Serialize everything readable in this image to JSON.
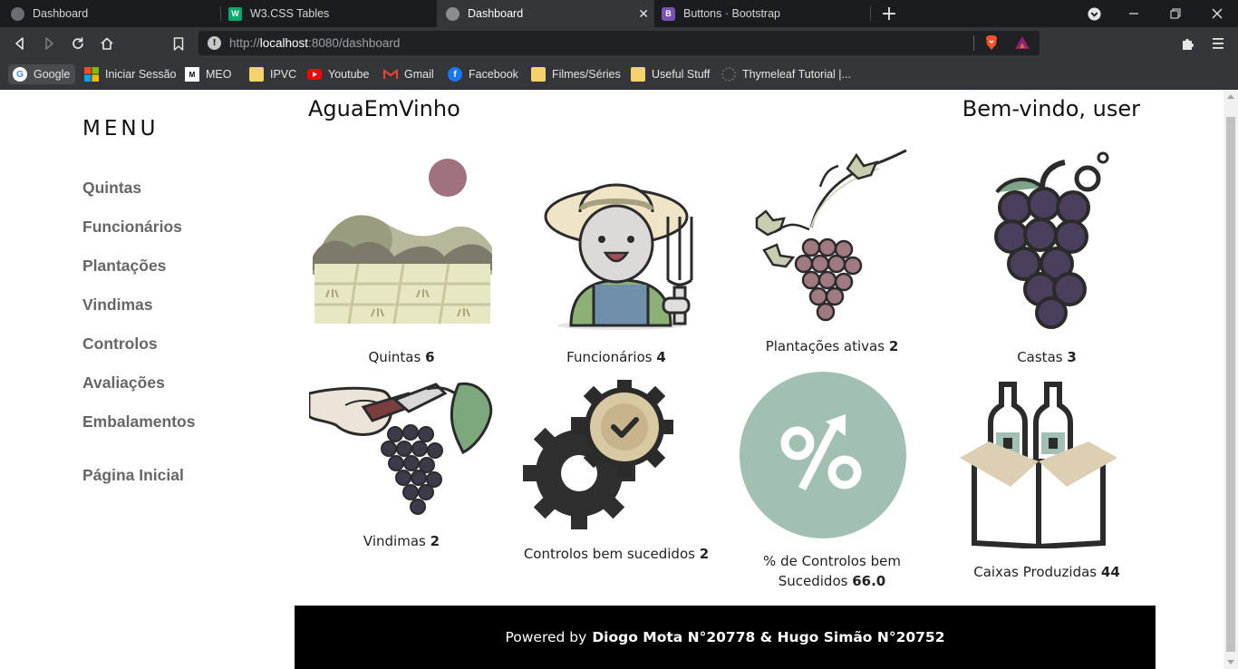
{
  "browser": {
    "tabs": [
      {
        "title": "Dashboard",
        "active": false
      },
      {
        "title": "W3.CSS Tables",
        "active": false
      },
      {
        "title": "Dashboard",
        "active": true
      },
      {
        "title": "Buttons · Bootstrap",
        "active": false
      }
    ],
    "new_tab_label": "+",
    "url_prefix": "http://",
    "url_host": "localhost",
    "url_rest": ":8080/dashboard",
    "bookmarks": [
      {
        "label": "Google"
      },
      {
        "label": "Iniciar Sessão"
      },
      {
        "label": "MEO"
      },
      {
        "label": "IPVC"
      },
      {
        "label": "Youtube"
      },
      {
        "label": "Gmail"
      },
      {
        "label": "Facebook"
      },
      {
        "label": "Filmes/Séries"
      },
      {
        "label": "Useful Stuff"
      },
      {
        "label": "Thymeleaf Tutorial |..."
      }
    ]
  },
  "sidebar": {
    "title": "MENU",
    "items": [
      "Quintas",
      "Funcionários",
      "Plantações",
      "Vindimas",
      "Controlos",
      "Avaliações",
      "Embalamentos"
    ],
    "home": "Página Inicial"
  },
  "header": {
    "brand": "AguaEmVinho",
    "welcome": "Bem-vindo, user"
  },
  "stats": [
    {
      "label": "Quintas",
      "value": "6"
    },
    {
      "label": "Funcionários",
      "value": "4"
    },
    {
      "label": "Plantações ativas",
      "value": "2"
    },
    {
      "label": "Castas",
      "value": "3"
    },
    {
      "label": "Vindimas",
      "value": "2"
    },
    {
      "label": "Controlos bem sucedidos",
      "value": "2"
    },
    {
      "label": "% de Controlos bem Sucedidos",
      "value": "66.0"
    },
    {
      "label": "Caixas Produzidas",
      "value": "44"
    }
  ],
  "footer": {
    "prefix": "Powered by",
    "authors": "Diogo Mota N°20778 & Hugo Simão N°20752"
  },
  "colors": {
    "tab_bg": "#1b1c1f",
    "toolbar_bg": "#35363a",
    "footer_bg": "#000000",
    "menu_text": "#666666",
    "grape": "#4a3f5c",
    "sage": "#9fbfb3"
  }
}
